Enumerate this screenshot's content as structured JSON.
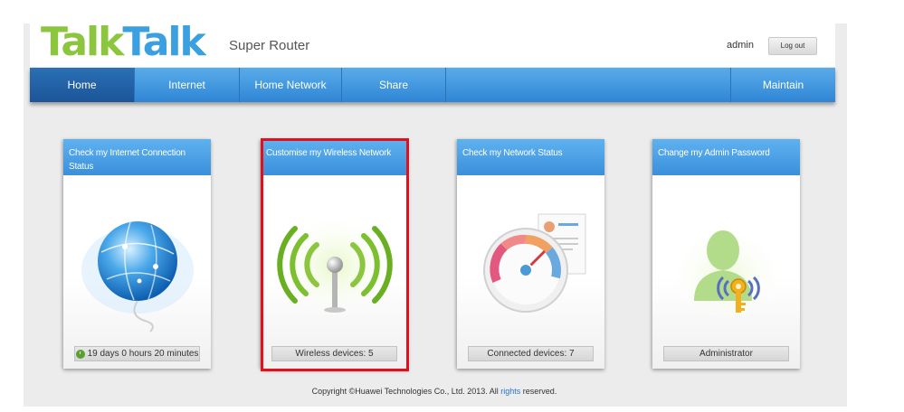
{
  "header": {
    "logo_text": "TalkTalk",
    "subtitle": "Super Router",
    "user": "admin",
    "logout_label": "Log out"
  },
  "nav": {
    "items": [
      {
        "label": "Home",
        "active": true
      },
      {
        "label": "Internet"
      },
      {
        "label": "Home Network"
      },
      {
        "label": "Share"
      },
      {
        "label": "Maintain"
      }
    ]
  },
  "cards": [
    {
      "title": "Check my Internet Connection Status",
      "status": "19 days 0 hours 20 minutes",
      "icon": "globe-icon"
    },
    {
      "title": "Customise my Wireless Network",
      "status": "Wireless devices: 5",
      "icon": "wireless-antenna-icon"
    },
    {
      "title": "Check my Network Status",
      "status": "Connected devices: 7",
      "icon": "speedometer-icon"
    },
    {
      "title": "Change my Admin Password",
      "status": "Administrator",
      "icon": "admin-key-icon"
    }
  ],
  "footer": {
    "prefix": "Copyright ©Huawei Technologies Co., Ltd. 2013. All",
    "link": "rights",
    "suffix": "reserved."
  },
  "colors": {
    "nav_blue": "#3a8fdb",
    "logo_green": "#8cc63f",
    "highlight_red": "#e3101c"
  }
}
